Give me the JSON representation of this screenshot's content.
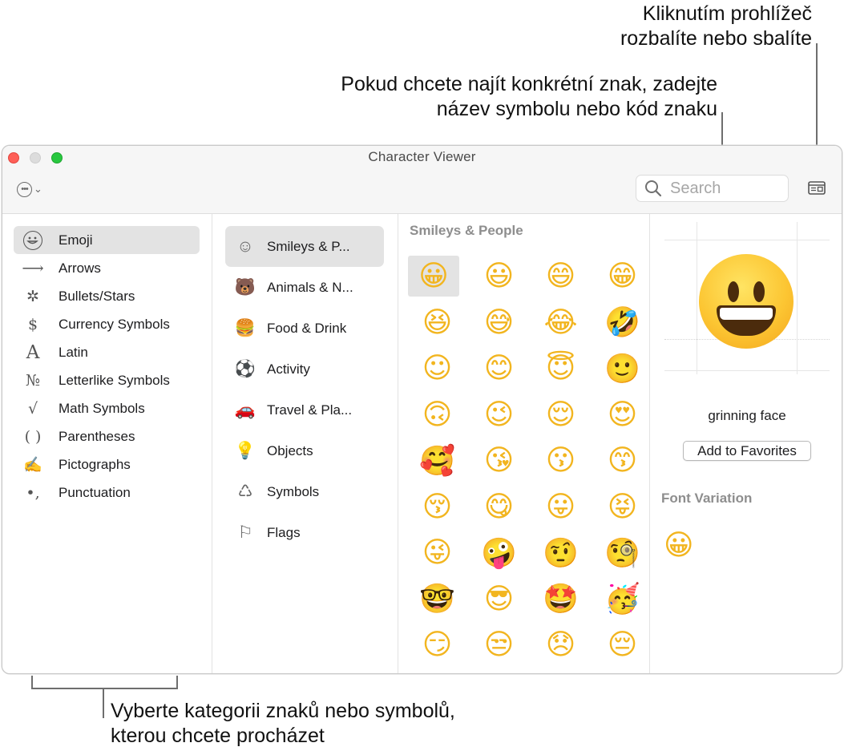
{
  "callouts": {
    "collapse": [
      "Kliknutím prohlížeč",
      "rozbalíte nebo sbalíte"
    ],
    "search": [
      "Pokud chcete najít konkrétní znak, zadejte",
      "název symbolu nebo kód znaku"
    ],
    "category": [
      "Vyberte kategorii znaků nebo symbolů,",
      "kterou chcete procházet"
    ]
  },
  "window": {
    "title": "Character Viewer"
  },
  "toolbar": {
    "action_icon": "ellipsis-circle-icon",
    "search_placeholder": "Search",
    "collapse_icon": "collapse-viewer-icon"
  },
  "categories": [
    {
      "label": "Emoji",
      "icon": "emoji-icon",
      "glyph": "",
      "selected": true
    },
    {
      "label": "Arrows",
      "icon": "arrow-icon",
      "glyph": "⟶",
      "selected": false
    },
    {
      "label": "Bullets/Stars",
      "icon": "bullets-stars-icon",
      "glyph": "✲",
      "selected": false
    },
    {
      "label": "Currency Symbols",
      "icon": "dollar-icon",
      "glyph": "$",
      "selected": false
    },
    {
      "label": "Latin",
      "icon": "latin-a-icon",
      "glyph": "A",
      "selected": false
    },
    {
      "label": "Letterlike Symbols",
      "icon": "numero-icon",
      "glyph": "№",
      "selected": false
    },
    {
      "label": "Math Symbols",
      "icon": "square-root-icon",
      "glyph": "√",
      "selected": false
    },
    {
      "label": "Parentheses",
      "icon": "parentheses-icon",
      "glyph": "( )",
      "selected": false
    },
    {
      "label": "Pictographs",
      "icon": "pictograph-icon",
      "glyph": "✍",
      "selected": false
    },
    {
      "label": "Punctuation",
      "icon": "punctuation-icon",
      "glyph": "•,",
      "selected": false
    }
  ],
  "subcategories": [
    {
      "label": "Smileys & P...",
      "icon": "smiley-icon",
      "glyph": "☺",
      "selected": true
    },
    {
      "label": "Animals & N...",
      "icon": "bear-icon",
      "glyph": "🐻",
      "selected": false
    },
    {
      "label": "Food & Drink",
      "icon": "food-icon",
      "glyph": "🍔",
      "selected": false
    },
    {
      "label": "Activity",
      "icon": "soccer-ball-icon",
      "glyph": "⚽",
      "selected": false
    },
    {
      "label": "Travel & Pla...",
      "icon": "travel-icon",
      "glyph": "🚗",
      "selected": false
    },
    {
      "label": "Objects",
      "icon": "lightbulb-icon",
      "glyph": "💡",
      "selected": false
    },
    {
      "label": "Symbols",
      "icon": "symbols-icon",
      "glyph": "♺",
      "selected": false
    },
    {
      "label": "Flags",
      "icon": "flag-icon",
      "glyph": "⚐",
      "selected": false
    }
  ],
  "grid": {
    "title": "Smileys & People",
    "emojis": [
      "😀",
      "😃",
      "😄",
      "😁",
      "😆",
      "😅",
      "😂",
      "🤣",
      "☺",
      "😊",
      "😇",
      "🙂",
      "🙃",
      "😉",
      "😌",
      "😍",
      "🥰",
      "😘",
      "😗",
      "😙",
      "😚",
      "😋",
      "😛",
      "😝",
      "😜",
      "🤪",
      "🤨",
      "🧐",
      "🤓",
      "😎",
      "🤩",
      "🥳",
      "😏",
      "😒",
      "😞",
      "😔"
    ],
    "selected_index": 0
  },
  "detail": {
    "char_name": "grinning face",
    "fav_label": "Add to Favorites",
    "font_variation_title": "Font Variation",
    "variation_emoji": "😀"
  }
}
